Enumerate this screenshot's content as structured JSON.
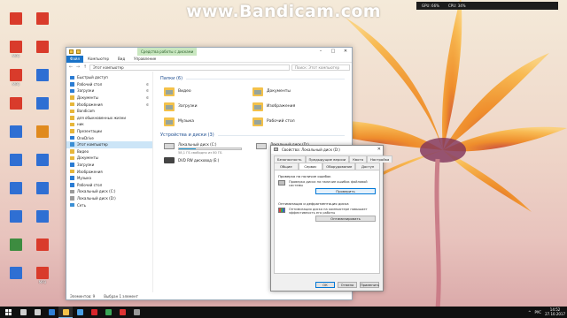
{
  "watermark": "www.Bandicam.com",
  "sysmon": {
    "gpu": "GPU: 66%",
    "cpu": "CPU: 34%"
  },
  "desktop_icons": [
    {
      "label": "",
      "color": "#d93b2b"
    },
    {
      "label": "MP3",
      "color": "#d93b2b"
    },
    {
      "label": "MP3",
      "color": "#d93b2b"
    },
    {
      "label": "",
      "color": "#d93b2b"
    },
    {
      "label": "",
      "color": "#2f6fd3"
    },
    {
      "label": "",
      "color": "#2f6fd3"
    },
    {
      "label": "",
      "color": "#2f6fd3"
    },
    {
      "label": "",
      "color": "#2f6fd3"
    },
    {
      "label": "",
      "color": "#3d8c40"
    },
    {
      "label": "",
      "color": "#2f6fd3"
    },
    {
      "label": "",
      "color": "#d93b2b"
    },
    {
      "label": "",
      "color": "#d93b2b"
    },
    {
      "label": "",
      "color": "#2f6fd3"
    },
    {
      "label": "",
      "color": "#2f6fd3"
    },
    {
      "label": "",
      "color": "#e08a1e"
    },
    {
      "label": "",
      "color": "#2f6fd3"
    },
    {
      "label": "",
      "color": "#2f6fd3"
    },
    {
      "label": "",
      "color": "#2f6fd3"
    },
    {
      "label": "",
      "color": "#d93b2b"
    },
    {
      "label": "MP3",
      "color": "#d93b2b"
    }
  ],
  "explorer": {
    "ribbon_context_tab": "Средства работы с дисками",
    "menu": {
      "file": "Файл",
      "computer": "Компьютер",
      "view": "Вид",
      "manage": "Управление"
    },
    "nav_back": "←",
    "nav_fwd": "→",
    "nav_up": "↑",
    "address": "Этот компьютер",
    "search_placeholder": "Поиск: Этот компьютер",
    "nav_pane": [
      {
        "label": "Быстрый доступ",
        "pin": "",
        "color": "#2b7cd3",
        "selected": false
      },
      {
        "label": "Рабочий стол",
        "pin": "✲",
        "color": "#2b7cd3",
        "selected": false
      },
      {
        "label": "Загрузки",
        "pin": "✲",
        "color": "#2b7cd3",
        "selected": false
      },
      {
        "label": "Документы",
        "pin": "✲",
        "color": "#e7b63a",
        "selected": false
      },
      {
        "label": "Изображения",
        "pin": "✲",
        "color": "#e7b63a",
        "selected": false
      },
      {
        "label": "Bandicam",
        "pin": "",
        "color": "#e7b63a",
        "selected": false
      },
      {
        "label": "для обыкновенных жизни",
        "pin": "",
        "color": "#e7b63a",
        "selected": false
      },
      {
        "label": "ник",
        "pin": "",
        "color": "#e7b63a",
        "selected": false
      },
      {
        "label": "Презентации",
        "pin": "",
        "color": "#e7b63a",
        "selected": false
      },
      {
        "label": "OneDrive",
        "pin": "",
        "color": "#2b7cd3",
        "selected": false
      },
      {
        "label": "Этот компьютер",
        "pin": "",
        "color": "#3b8fd4",
        "selected": true
      },
      {
        "label": "Видео",
        "pin": "",
        "color": "#e7b63a",
        "selected": false
      },
      {
        "label": "Документы",
        "pin": "",
        "color": "#e7b63a",
        "selected": false
      },
      {
        "label": "Загрузки",
        "pin": "",
        "color": "#2b7cd3",
        "selected": false
      },
      {
        "label": "Изображения",
        "pin": "",
        "color": "#e7b63a",
        "selected": false
      },
      {
        "label": "Музыка",
        "pin": "",
        "color": "#2b7cd3",
        "selected": false
      },
      {
        "label": "Рабочий стол",
        "pin": "",
        "color": "#2b7cd3",
        "selected": false
      },
      {
        "label": "Локальный диск (C:)",
        "pin": "",
        "color": "#9a9a9a",
        "selected": false
      },
      {
        "label": "Локальный диск (D:)",
        "pin": "",
        "color": "#9a9a9a",
        "selected": false
      },
      {
        "label": "Сеть",
        "pin": "",
        "color": "#3b8fd4",
        "selected": false
      }
    ],
    "folders_header": "Папки (6)",
    "folders": [
      "Видео",
      "Документы",
      "Загрузки",
      "Изображения",
      "Музыка",
      "Рабочий стол"
    ],
    "devices_header": "Устройства и диски (3)",
    "drives": [
      {
        "name": "Локальный диск (C:)",
        "free": "58,1 ГБ свободно из 80 ГБ",
        "used_pct": 27
      },
      {
        "name": "Локальный диск (D:)",
        "free": "",
        "used_pct": 60
      }
    ],
    "dvd": "DVD RW дисковод (E:)",
    "status_items": "Элементов: 9",
    "status_selected": "Выбран 1 элемент"
  },
  "dialog": {
    "title": "Свойства: Локальный диск (D:)",
    "close": "✕",
    "tabs_row1": [
      "Безопасность",
      "Предыдущие версии",
      "Квота",
      "Настройка"
    ],
    "tabs_row2": [
      "Общие",
      "Сервис",
      "Оборудование",
      "Доступ"
    ],
    "active_tab": "Сервис",
    "check_title": "Проверка на наличие ошибок",
    "check_text": "Проверка диска на наличие ошибок файловой системы",
    "check_button": "Проверить",
    "defrag_title": "Оптимизация и дефрагментация диска",
    "defrag_text": "Оптимизация диска на компьютере повышает эффективность его работы",
    "defrag_button": "Оптимизировать",
    "ok": "ОК",
    "cancel": "Отмена",
    "apply": "Применить"
  },
  "taskbar": {
    "apps": [
      {
        "name": "search",
        "color": "#cfcfcf"
      },
      {
        "name": "task-view",
        "color": "#cfcfcf"
      },
      {
        "name": "edge",
        "color": "#2f7fd6"
      },
      {
        "name": "explorer",
        "color": "#f3c14a"
      },
      {
        "name": "store",
        "color": "#4aa0e6"
      },
      {
        "name": "opera",
        "color": "#d8262c"
      },
      {
        "name": "chrome",
        "color": "#3aa757"
      },
      {
        "name": "bandicam",
        "color": "#d33"
      },
      {
        "name": "media",
        "color": "#999"
      }
    ],
    "lang": "РУС",
    "time": "14:52",
    "date": "27.10.2017"
  }
}
